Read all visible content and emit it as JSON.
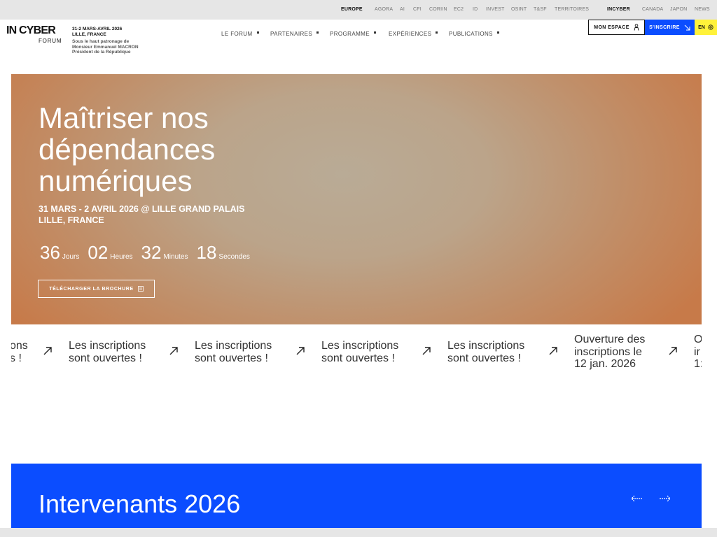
{
  "topbar": {
    "europe": "EUROPE",
    "links": [
      "AGORA",
      "AI",
      "CFI",
      "CORIIN",
      "EC2",
      "ID",
      "INVEST",
      "OSINT",
      "T&SF",
      "TERRITOIRES"
    ],
    "incyber": "INCYBER",
    "regions": [
      "CANADA",
      "JAPON",
      "NEWS"
    ]
  },
  "header": {
    "logo": "IN CYBER",
    "logo_sub": "FORUM",
    "dates": "31-2 MARS-AVRIL 2026",
    "place": "LILLE, FRANCE",
    "patronage1": "Sous le haut patronage de",
    "patronage2": "Monsieur Emmanuel MACRON",
    "patronage3": "Président de la République",
    "nav": [
      "LE FORUM",
      "PARTENAIRES",
      "PROGRAMME",
      "EXPÉRIENCES",
      "PUBLICATIONS"
    ],
    "mon_espace": "MON ESPACE",
    "sinscrire": "S'INSCRIRE",
    "lang": "EN"
  },
  "hero": {
    "title_line1": "Maîtriser nos",
    "title_line2": "dépendances",
    "title_line3": "numériques",
    "date_line1": "31 MARS - 2 AVRIL 2026 @ LILLE GRAND PALAIS",
    "date_line2": "LILLE, FRANCE",
    "countdown": {
      "days": "36",
      "days_label": "Jours",
      "hours": "02",
      "hours_label": "Heures",
      "minutes": "32",
      "minutes_label": "Minutes",
      "seconds": "18",
      "seconds_label": "Secondes"
    },
    "brochure": "TÉLÉCHARGER LA BROCHURE"
  },
  "ticker": {
    "partial_left_1": "ons",
    "partial_left_2": "s !",
    "item_line1": "Les inscriptions",
    "item_line2": "sont ouvertes !",
    "open_line1": "Ouverture des",
    "open_line2": "inscriptions le",
    "open_line3": "12 jan. 2026",
    "partial_right_1": "O",
    "partial_right_2": "ir",
    "partial_right_3": "1:"
  },
  "speakers": {
    "title": "Intervenants 2026"
  },
  "colors": {
    "accent_blue": "#0b4dff",
    "accent_yellow": "#fff23a",
    "hero_orange": "#c77a49"
  }
}
